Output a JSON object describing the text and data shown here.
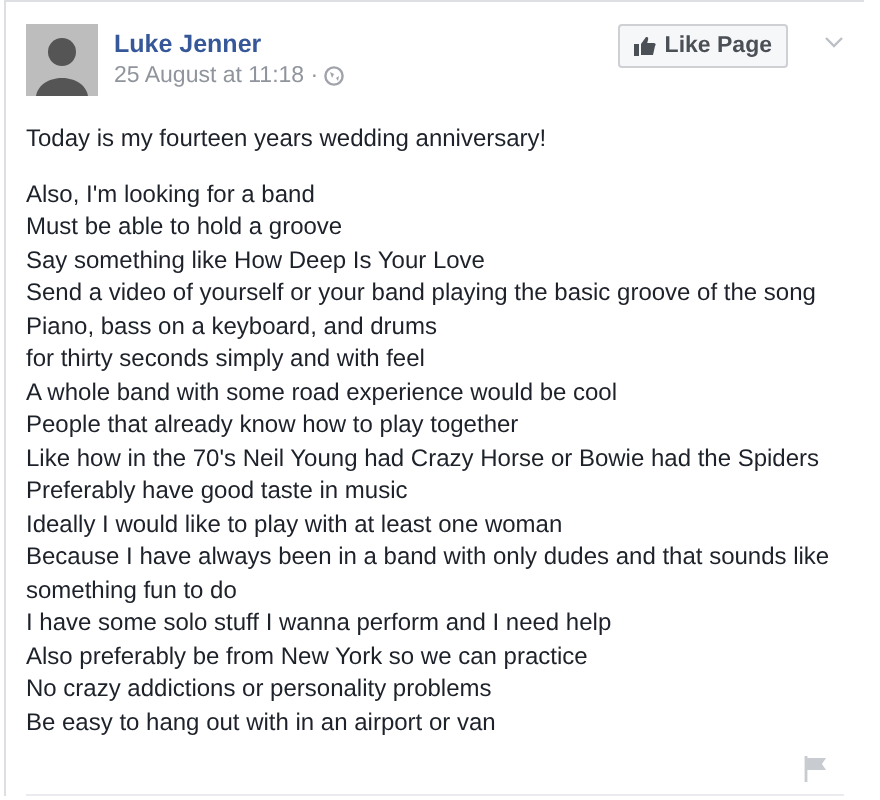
{
  "post": {
    "author": "Luke Jenner",
    "timestamp": "25 August at 11:18 ·",
    "like_button": "Like Page",
    "intro": "Today is my fourteen years wedding anniversary!",
    "lines": [
      "Also, I'm looking for a band",
      "Must be able to hold a groove",
      "Say something like How Deep Is Your Love",
      "Send a video of yourself or your band playing the basic groove of the song",
      "Piano, bass on a keyboard, and drums",
      "for thirty seconds simply and with feel",
      "A whole band with some road experience would be cool",
      "People that already know how to play together",
      "Like how in the 70's Neil Young had Crazy Horse or Bowie had the Spiders",
      "Preferably have good taste in music",
      "Ideally I would like to play with at least one woman",
      "Because I have always been in a band with only dudes and that sounds like something fun to do",
      "I have some solo stuff I wanna perform and I need help",
      "Also preferably be from New York so we can practice",
      "No crazy addictions or personality problems",
      "Be easy to hang out with in an airport or van"
    ]
  }
}
